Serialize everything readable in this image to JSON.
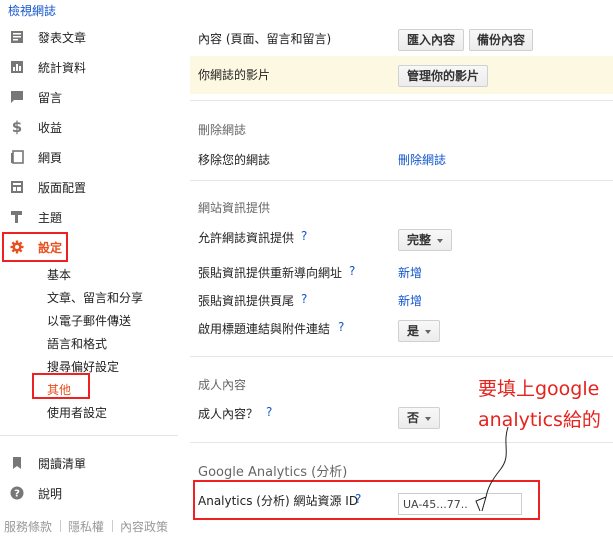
{
  "header": {
    "view_blog": "檢視網誌"
  },
  "sidebar": {
    "items": [
      {
        "label": "發表文章",
        "icon": "posts-icon"
      },
      {
        "label": "統計資料",
        "icon": "stats-icon"
      },
      {
        "label": "留言",
        "icon": "comments-icon"
      },
      {
        "label": "收益",
        "icon": "earnings-icon"
      },
      {
        "label": "網頁",
        "icon": "pages-icon"
      },
      {
        "label": "版面配置",
        "icon": "layout-icon"
      },
      {
        "label": "主題",
        "icon": "theme-icon"
      },
      {
        "label": "設定",
        "icon": "gear-icon"
      }
    ],
    "sub_items": [
      "基本",
      "文章、留言和分享",
      "以電子郵件傳送",
      "語言和格式",
      "搜尋偏好設定",
      "其他",
      "使用者設定"
    ],
    "bottom_items": [
      {
        "label": "閱讀清單",
        "icon": "bookmark-icon"
      },
      {
        "label": "說明",
        "icon": "help-icon"
      }
    ],
    "footer": [
      "服務條款",
      "隱私權",
      "內容政策"
    ],
    "accent_color": "#e5231d"
  },
  "main": {
    "import_row": {
      "label": "內容 (頁面、留言和留言)",
      "import_button": "匯入內容",
      "backup_button": "備份內容"
    },
    "videos_row": {
      "label": "你網誌的影片",
      "manage_button": "管理你的影片"
    },
    "delete_section": {
      "title": "刪除網誌",
      "label": "移除您的網誌",
      "link": "刪除網誌"
    },
    "feed_section": {
      "title": "網站資訊提供",
      "rows": [
        {
          "label": "允許網誌資訊提供",
          "help": "?",
          "value": "完整"
        },
        {
          "label": "張貼資訊提供重新導向網址",
          "help": "?",
          "value": "新增"
        },
        {
          "label": "張貼資訊提供頁尾",
          "help": "?",
          "value": "新增"
        },
        {
          "label": "啟用標題連結與附件連結",
          "help": "?",
          "value": "是"
        }
      ]
    },
    "adult_section": {
      "title": "成人內容",
      "label": "成人內容？",
      "help": "?",
      "value": "否"
    },
    "ga_section": {
      "title": "Google Analytics (分析)",
      "label": "Analytics (分析) 網站資源 ID",
      "help": "?",
      "input_value": "UA-45...77.."
    }
  },
  "annotation": {
    "line1": "要填上google",
    "line2": "analytics給的"
  }
}
